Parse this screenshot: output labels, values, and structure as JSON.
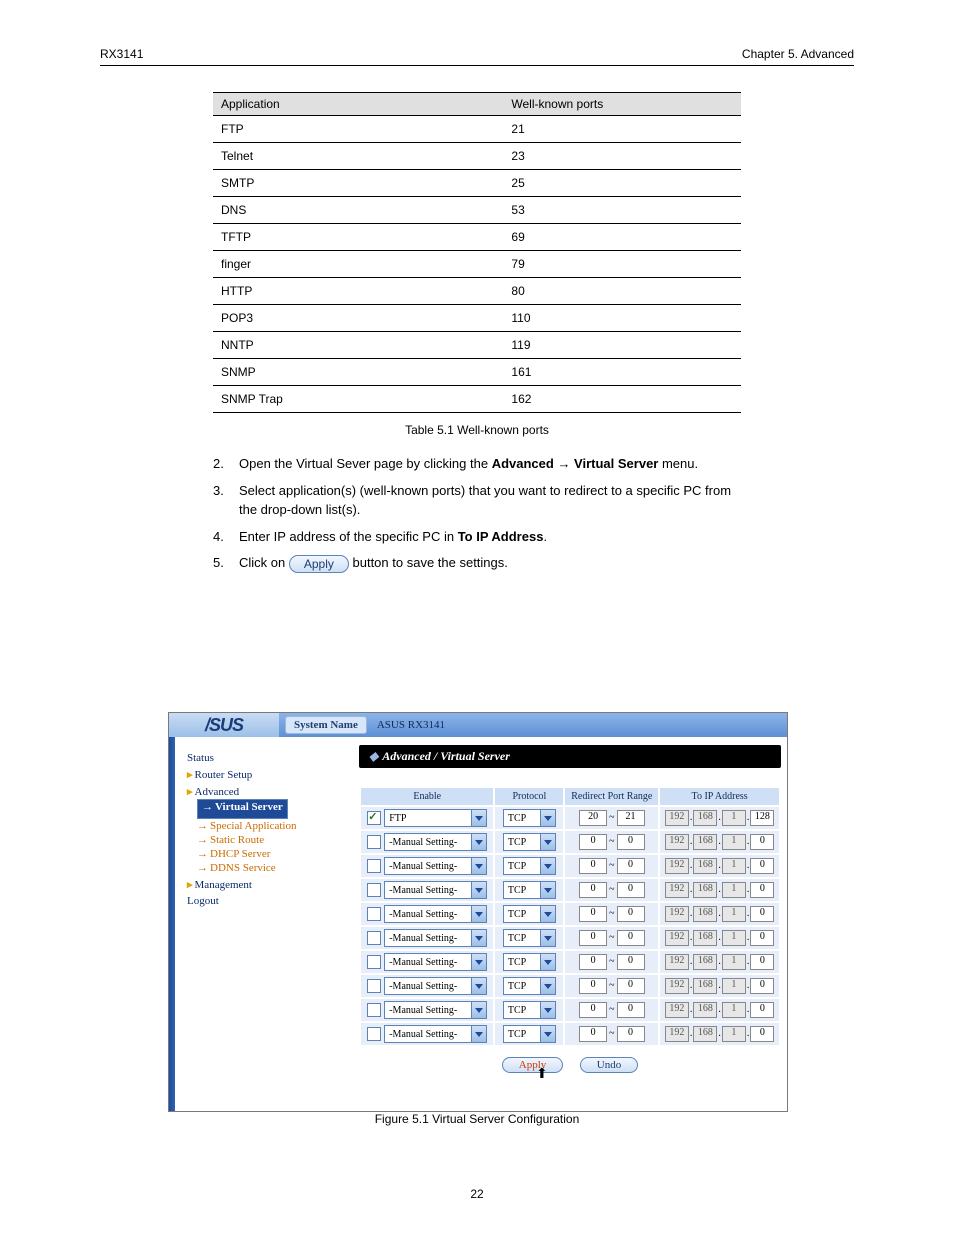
{
  "running_head": {
    "left": "RX3141",
    "right": "Chapter 5. Advanced"
  },
  "common_ports": {
    "head": {
      "app": "Application",
      "port": "Well-known ports"
    },
    "rows": [
      {
        "app": "FTP",
        "port": "21"
      },
      {
        "app": "Telnet",
        "port": "23"
      },
      {
        "app": "SMTP",
        "port": "25"
      },
      {
        "app": "DNS",
        "port": "53"
      },
      {
        "app": "TFTP",
        "port": "69"
      },
      {
        "app": "finger",
        "port": "79"
      },
      {
        "app": "HTTP",
        "port": "80"
      },
      {
        "app": "POP3",
        "port": "110"
      },
      {
        "app": "NNTP",
        "port": "119"
      },
      {
        "app": "SNMP",
        "port": "161"
      },
      {
        "app": "SNMP Trap",
        "port": "162"
      }
    ]
  },
  "table_caption": "Table 5.1 Well-known ports",
  "steps": [
    {
      "n": "2.",
      "t": "Open the Virtual Sever page by clicking the <b>Advanced <span class='arrow'>→</span> Virtual Server</b> menu."
    },
    {
      "n": "3.",
      "t": "Select application(s) (well-known ports) that you want to redirect to a specific PC from the drop-down list(s)."
    },
    {
      "n": "4.",
      "t": "Enter IP address of the specific PC in <b>To IP Address</b>."
    },
    {
      "n": "5.0",
      "t": "Click on "
    },
    {
      "n": "5.1",
      "t": " button to save the settings."
    }
  ],
  "shot": {
    "system_label": "System Name",
    "system_name": "ASUS RX3141",
    "nav": {
      "status": "Status",
      "router": "Router Setup",
      "advanced": "Advanced",
      "virtual": "Virtual Server",
      "special": "Special Application",
      "sroute": "Static Route",
      "dhcp": "DHCP Server",
      "ddns": "DDNS Service",
      "mgmt": "Management",
      "logout": "Logout"
    },
    "crumb": "Advanced / Virtual Server",
    "headers": {
      "enable": "Enable",
      "protocol": "Protocol",
      "range": "Redirect Port Range",
      "ip": "To IP Address"
    },
    "rows": [
      {
        "chk": true,
        "app": "FTP",
        "proto": "TCP",
        "p1": "20",
        "p2": "21",
        "ip": [
          "192",
          "168",
          "1",
          "128"
        ]
      },
      {
        "chk": false,
        "app": "-Manual Setting-",
        "proto": "TCP",
        "p1": "0",
        "p2": "0",
        "ip": [
          "192",
          "168",
          "1",
          "0"
        ]
      },
      {
        "chk": false,
        "app": "-Manual Setting-",
        "proto": "TCP",
        "p1": "0",
        "p2": "0",
        "ip": [
          "192",
          "168",
          "1",
          "0"
        ]
      },
      {
        "chk": false,
        "app": "-Manual Setting-",
        "proto": "TCP",
        "p1": "0",
        "p2": "0",
        "ip": [
          "192",
          "168",
          "1",
          "0"
        ]
      },
      {
        "chk": false,
        "app": "-Manual Setting-",
        "proto": "TCP",
        "p1": "0",
        "p2": "0",
        "ip": [
          "192",
          "168",
          "1",
          "0"
        ]
      },
      {
        "chk": false,
        "app": "-Manual Setting-",
        "proto": "TCP",
        "p1": "0",
        "p2": "0",
        "ip": [
          "192",
          "168",
          "1",
          "0"
        ]
      },
      {
        "chk": false,
        "app": "-Manual Setting-",
        "proto": "TCP",
        "p1": "0",
        "p2": "0",
        "ip": [
          "192",
          "168",
          "1",
          "0"
        ]
      },
      {
        "chk": false,
        "app": "-Manual Setting-",
        "proto": "TCP",
        "p1": "0",
        "p2": "0",
        "ip": [
          "192",
          "168",
          "1",
          "0"
        ]
      },
      {
        "chk": false,
        "app": "-Manual Setting-",
        "proto": "TCP",
        "p1": "0",
        "p2": "0",
        "ip": [
          "192",
          "168",
          "1",
          "0"
        ]
      },
      {
        "chk": false,
        "app": "-Manual Setting-",
        "proto": "TCP",
        "p1": "0",
        "p2": "0",
        "ip": [
          "192",
          "168",
          "1",
          "0"
        ]
      }
    ],
    "apply": "Apply",
    "undo": "Undo"
  },
  "fig_caption": "Figure 5.1 Virtual Server Configuration",
  "page_number": "22"
}
